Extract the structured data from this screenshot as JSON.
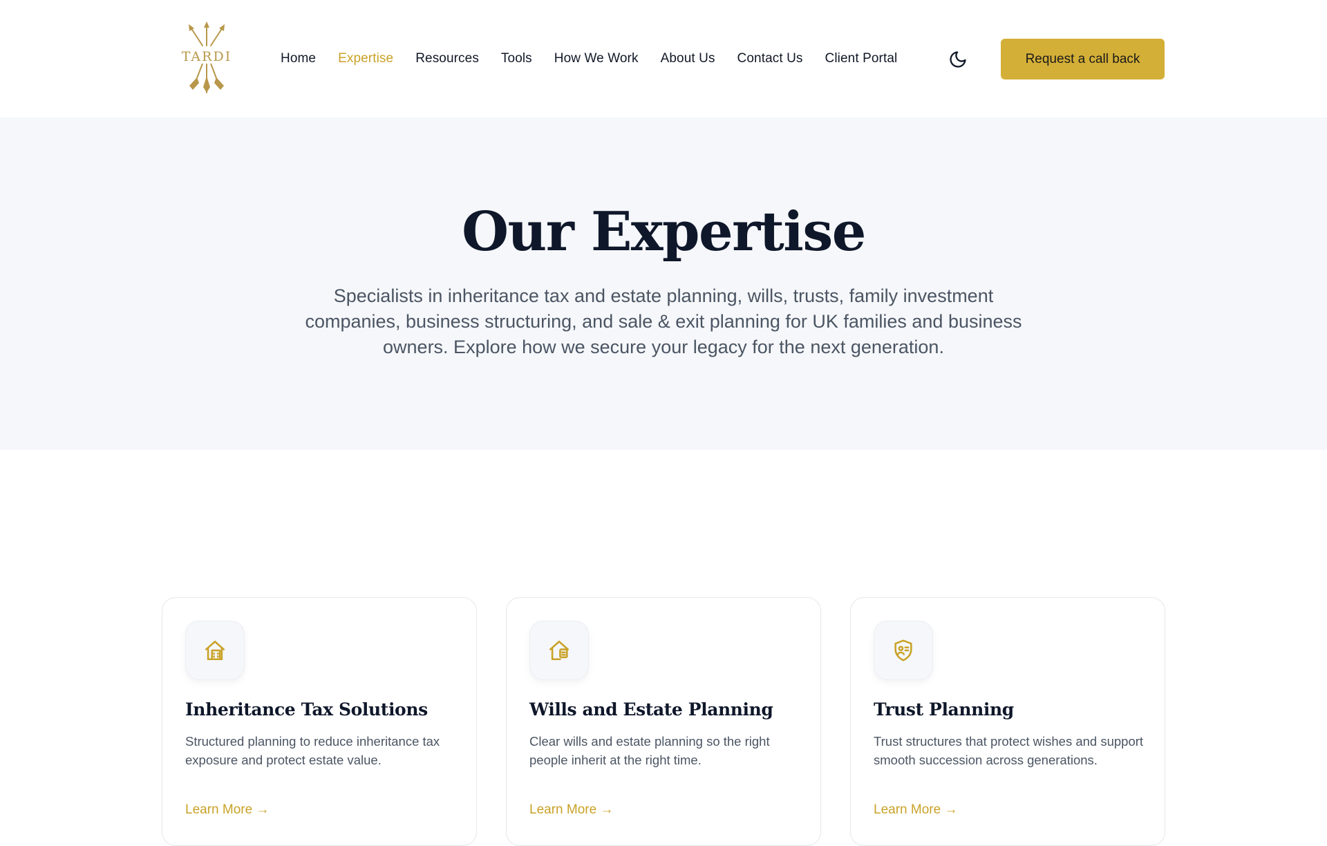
{
  "brand": {
    "logo_text": "TARDI",
    "accent_color": "#d4af37"
  },
  "nav": {
    "items": [
      {
        "label": "Home",
        "active": false
      },
      {
        "label": "Expertise",
        "active": true
      },
      {
        "label": "Resources",
        "active": false
      },
      {
        "label": "Tools",
        "active": false
      },
      {
        "label": "How We Work",
        "active": false
      },
      {
        "label": "About Us",
        "active": false
      },
      {
        "label": "Contact Us",
        "active": false
      },
      {
        "label": "Client Portal",
        "active": false
      }
    ],
    "theme_toggle_icon": "moon-icon",
    "cta_label": "Request a call back"
  },
  "hero": {
    "title": "Our Expertise",
    "description": "Specialists in inheritance tax and estate planning, wills, trusts, family investment companies, business structuring, and sale & exit planning for UK families and business owners. Explore how we secure your legacy for the next generation."
  },
  "cards": [
    {
      "icon": "building-icon",
      "title": "Inheritance Tax Solutions",
      "description": "Structured planning to reduce inheritance tax exposure and protect estate value.",
      "link": "Learn More →"
    },
    {
      "icon": "house-document-icon",
      "title": "Wills and Estate Planning",
      "description": "Clear wills and estate planning so the right people inherit at the right time.",
      "link": "Learn More →"
    },
    {
      "icon": "shield-person-icon",
      "title": "Trust Planning",
      "description": "Trust structures that protect wishes and support smooth succession across generations.",
      "link": "Learn More →"
    }
  ]
}
